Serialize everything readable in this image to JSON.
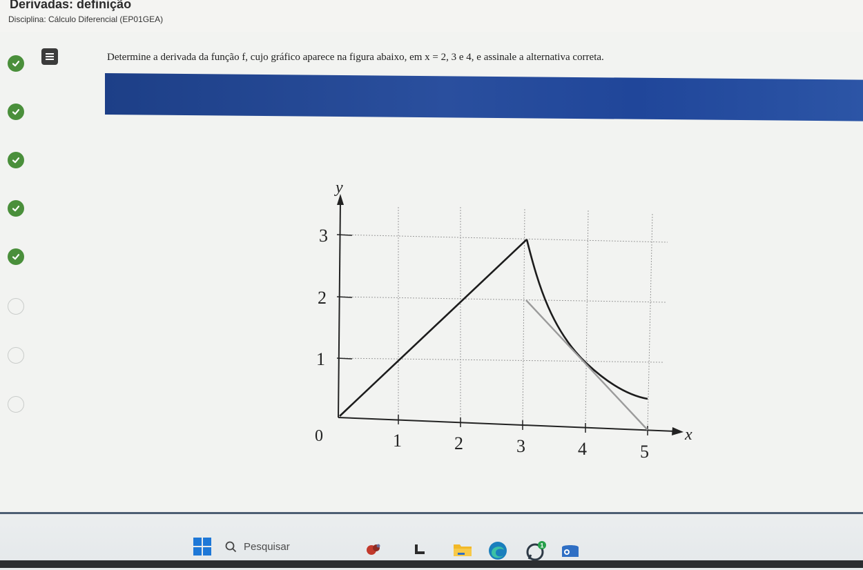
{
  "header": {
    "title": "Derivadas: definição",
    "course": "Disciplina: Cálculo Diferencial (EP01GEA)"
  },
  "progress": {
    "steps": [
      {
        "status": "done"
      },
      {
        "status": "done"
      },
      {
        "status": "done"
      },
      {
        "status": "done"
      },
      {
        "status": "done"
      },
      {
        "status": "pending"
      },
      {
        "status": "pending"
      },
      {
        "status": "pending"
      }
    ]
  },
  "question": {
    "text": "Determine a derivada da função f, cujo gráfico aparece na figura abaixo, em x = 2, 3 e 4, e assinale a alternativa correta."
  },
  "graph": {
    "y_axis_label": "y",
    "x_axis_label": "x",
    "origin_label": "0",
    "x_ticks": [
      "1",
      "2",
      "3",
      "4",
      "5"
    ],
    "y_ticks": [
      "1",
      "2",
      "3"
    ]
  },
  "taskbar": {
    "search_placeholder": "Pesquisar",
    "search_icon": "search-icon",
    "start_icon": "windows-start-icon",
    "badge_count": "1"
  },
  "colors": {
    "done": "#4a8f3b",
    "banner": "#1d3f87",
    "start": "#1e78d7"
  }
}
